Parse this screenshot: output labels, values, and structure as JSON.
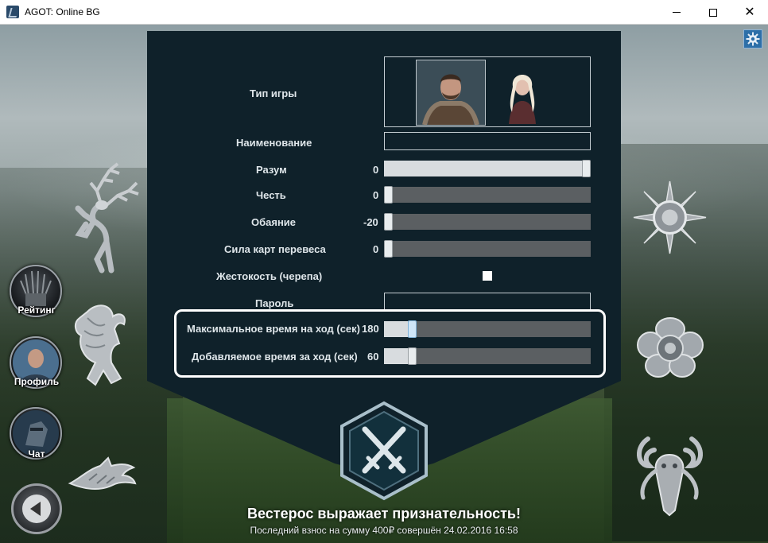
{
  "window": {
    "title": "AGOT: Online BG",
    "close_glyph": "✕"
  },
  "nav": {
    "rating": "Рейтинг",
    "profile": "Профиль",
    "chat": "Чат"
  },
  "form": {
    "game_type_label": "Тип игры",
    "name_label": "Наименование",
    "name_value": "",
    "password_label": "Пароль",
    "password_value": "",
    "cruelty_label": "Жестокость (черепа)",
    "cruelty_checked": false,
    "sliders": [
      {
        "label": "Разум",
        "value": "0",
        "fraction": 1.0
      },
      {
        "label": "Честь",
        "value": "0",
        "fraction": 0.0
      },
      {
        "label": "Обаяние",
        "value": "-20",
        "fraction": 0.0
      },
      {
        "label": "Сила карт перевеса",
        "value": "0",
        "fraction": 0.0
      }
    ],
    "time_sliders": [
      {
        "label": "Максимальное время на ход (сек)",
        "value": "180",
        "fraction": 0.12
      },
      {
        "label": "Добавляемое время за ход (сек)",
        "value": "60",
        "fraction": 0.12
      }
    ]
  },
  "footer": {
    "thanks": "Вестерос выражает признательность!",
    "donation": "Последний взнос на сумму 400₽ совершён 24.02.2016 16:58"
  },
  "colors": {
    "panel": "#0f212a",
    "accent": "#2d6fa8",
    "track": "#5b5f62"
  }
}
